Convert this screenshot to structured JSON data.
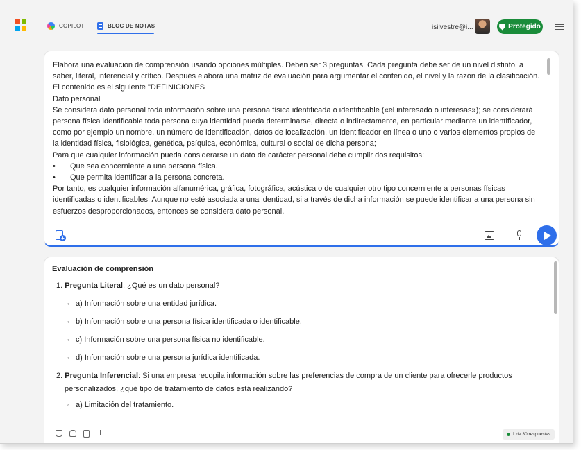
{
  "colors": {
    "accent": "#2f6fea",
    "protect_green": "#1a8c3a",
    "ms_logo": [
      "#f25022",
      "#7fba00",
      "#00a4ef",
      "#ffb900"
    ]
  },
  "header": {
    "tabs": [
      {
        "label": "COPILOT",
        "icon": "copilot-icon"
      },
      {
        "label": "BLOC DE NOTAS",
        "icon": "notes-icon",
        "active": true
      }
    ],
    "user": "isilvestre@i...",
    "protected_label": "Protegido",
    "menu_icon": "hamburger-menu-icon"
  },
  "prompt": {
    "lines": [
      "Elabora una evaluación de comprensión usando opciones múltiples. Deben ser 3 preguntas. Cada pregunta debe ser de un nivel distinto, a",
      "saber, literal, inferencial y crítico. Después elabora una matriz de evaluación para argumentar el contenido, el nivel y la razón de la clasificación.",
      "El contenido es el siguiente \"DEFINICIONES",
      "Dato personal",
      "Se considera dato personal toda información sobre una persona física identificada o identificable («el interesado o interesas»); se considerará",
      "persona física identificable toda persona cuya identidad pueda determinarse, directa o indirectamente, en particular mediante un identificador,",
      "como por ejemplo un nombre, un número de identificación, datos de localización, un identificador en línea o uno o varios elementos propios de",
      "la identidad física, fisiológica, genética, psíquica, económica, cultural o social de dicha persona;",
      "Para que cualquier información pueda considerarse un dato de carácter personal debe cumplir dos requisitos:"
    ],
    "bullets": [
      "Que sea concerniente a una persona física.",
      "Que permita identificar a la persona concreta."
    ],
    "tail_lines": [
      "Por tanto, es cualquier información alfanumérica, gráfica, fotográfica, acústica o de cualquier otro tipo concerniente a personas físicas",
      "identificadas o identificables. Aunque no esté asociada a una identidad, si a través de dicha información se puede identificar a una persona sin",
      "esfuerzos desproporcionados, entonces se considera dato personal."
    ]
  },
  "response": {
    "title": "Evaluación de comprensión",
    "q1": {
      "num": "1.",
      "label": "Pregunta Literal",
      "text": ": ¿Qué es un dato personal?"
    },
    "q1_options": [
      "a) Información sobre una entidad jurídica.",
      "b) Información sobre una persona física identificada o identificable.",
      "c) Información sobre una persona física no identificable.",
      "d) Información sobre una persona jurídica identificada."
    ],
    "q2": {
      "num": "2.",
      "label": "Pregunta Inferencial",
      "text": ": Si una empresa recopila información sobre las preferencias de compra de un cliente para ofrecerle productos personalizados, ¿qué tipo de tratamiento de datos está realizando?"
    },
    "q2_options": [
      "a) Limitación del tratamiento."
    ],
    "counter": "1 de 30 respuestas"
  }
}
